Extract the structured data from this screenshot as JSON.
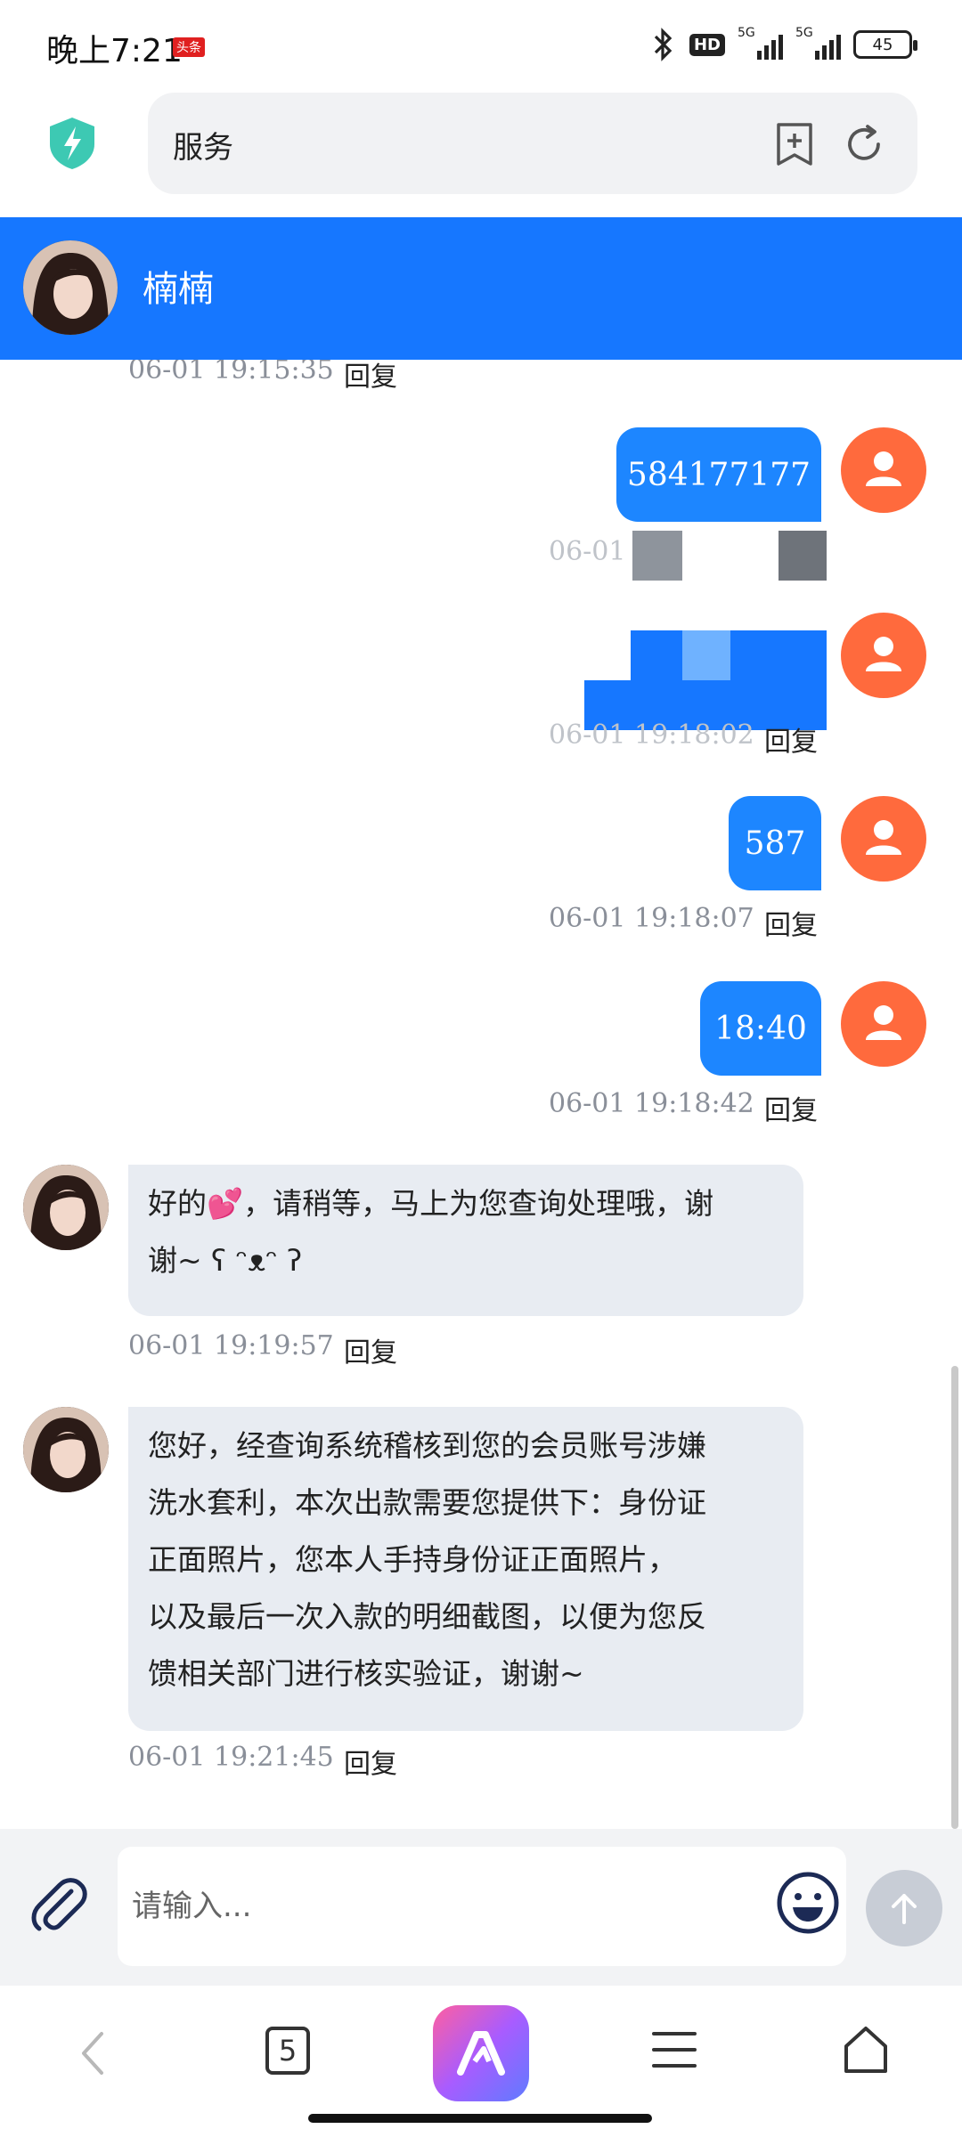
{
  "status_bar": {
    "time": "晚上7:21",
    "badge": "头条",
    "hd": "HD",
    "net1": "5G",
    "net2": "5G",
    "battery": "45"
  },
  "browser": {
    "url_text": "服务"
  },
  "chat": {
    "contact_name": "楠楠",
    "reply_label": "回复",
    "messages": [
      {
        "from": "agent",
        "time": "06-01 19:15:35"
      },
      {
        "from": "user",
        "text": "584177177",
        "time": "06-01"
      },
      {
        "from": "user",
        "text": "",
        "time": "06-01 19:18:02"
      },
      {
        "from": "user",
        "text": "587",
        "time": "06-01 19:18:07"
      },
      {
        "from": "user",
        "text": "18:40",
        "time": "06-01 19:18:42"
      },
      {
        "from": "agent",
        "lines": [
          "好的💕，请稍等，马上为您查询处理哦，谢",
          "谢~ ʕ ᵔᴥᵔ ʔ"
        ],
        "time": "06-01 19:19:57"
      },
      {
        "from": "agent",
        "lines": [
          "您好，经查询系统稽核到您的会员账号涉嫌",
          "洗水套利，本次出款需要您提供下：身份证",
          "正面照片，您本人手持身份证正面照片，",
          "以及最后一次入款的明细截图，以便为您反",
          "馈相关部门进行核实验证，谢谢~"
        ],
        "time": "06-01 19:21:45"
      }
    ]
  },
  "input": {
    "placeholder": "请输入..."
  },
  "bottom_nav": {
    "tab_count": "5"
  },
  "colors": {
    "header_blue": "#1677ff",
    "bubble_blue": "#1d86ff",
    "user_avatar_orange": "#ff6a3d",
    "agent_bubble_gray": "#e8ecf2"
  }
}
